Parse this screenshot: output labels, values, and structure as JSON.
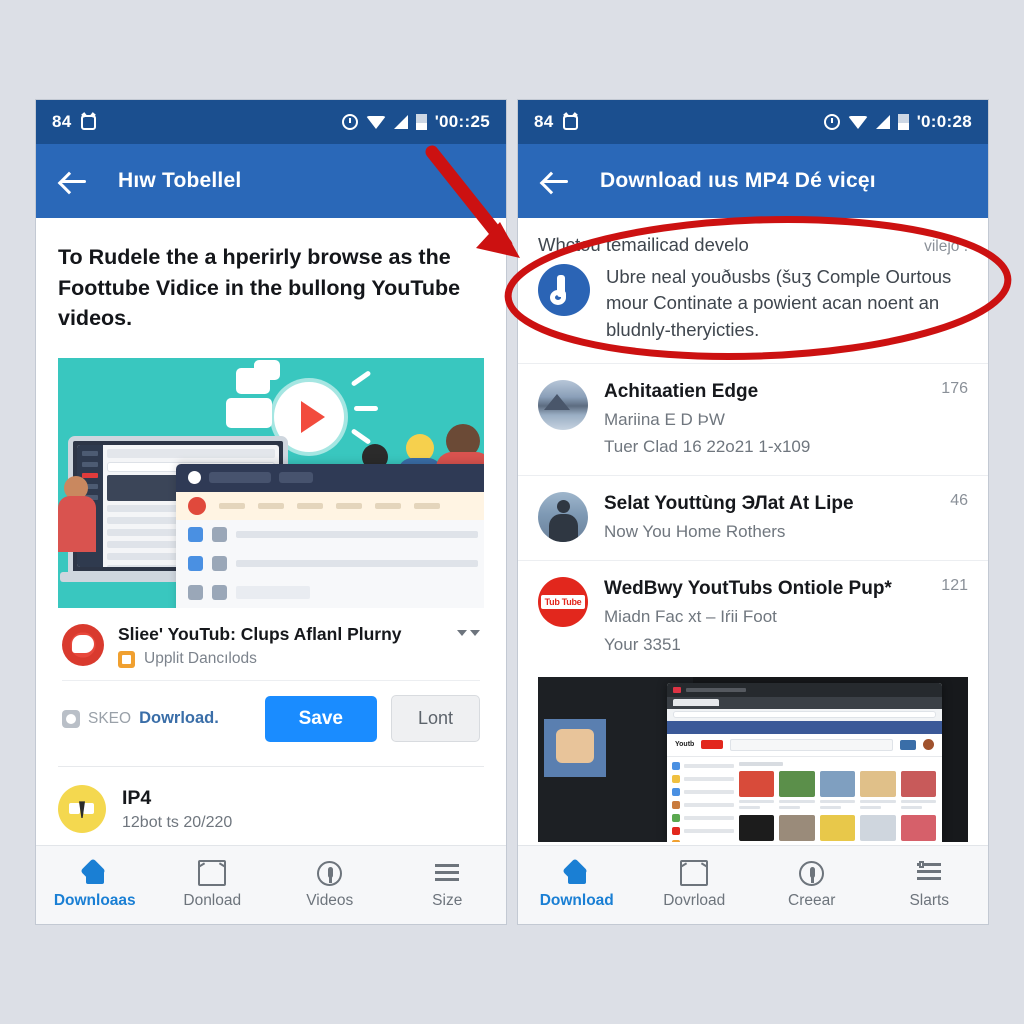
{
  "meta": {
    "accent_blue": "#2a68b8",
    "status_blue": "#1b4f8f",
    "save_blue": "#1a8cff",
    "annotation_red": "#cc1111",
    "page_background": "#dcdfe6"
  },
  "left_panel": {
    "status_bar": {
      "battery_percent": "84",
      "alarm_icon": "alarm-icon",
      "clock_icon": "clock-icon",
      "wifi_icon": "wifi-icon",
      "signal_icon": "signal-icon",
      "battery_icon": "battery-icon",
      "time": "'00::25"
    },
    "app_bar": {
      "back_icon": "back-arrow-icon",
      "title": "Hıw Tobellel"
    },
    "lead_paragraph": "To Rudele the a hperirly browse as the Foottube Vidice in the bullong YouTube videos.",
    "illustration": {
      "alt": "teal illustration with laptop, play button and cartoon people",
      "background": "#39c7bf",
      "play_icon": "play-button-icon"
    },
    "card": {
      "avatar_icon": "channel-avatar-icon",
      "title": "Sliee' YouTub: Clups Aflanl Plurny",
      "badge_icon": "upload-badge-icon",
      "subtitle": "Upplit Dancılods",
      "caret_icon": "chevron-down-icon",
      "seo_icon": "seo-dot-icon",
      "seo_label": "SKEO",
      "seo_link": "Dowrload.",
      "save_label": "Save",
      "ghost_label": "Lont"
    },
    "mp4_row": {
      "icon": "mp4-face-icon",
      "title": "IP4",
      "subtitle": "12bot ts 20/220"
    },
    "bottom_nav": [
      {
        "label": "Downloaas",
        "icon": "home-icon",
        "active": true
      },
      {
        "label": "Donload",
        "icon": "chart-icon",
        "active": false
      },
      {
        "label": "Videos",
        "icon": "pin-icon",
        "active": false
      },
      {
        "label": "Size",
        "icon": "menu-icon",
        "active": false
      }
    ]
  },
  "right_panel": {
    "status_bar": {
      "battery_percent": "84",
      "alarm_icon": "alarm-icon",
      "clock_icon": "clock-icon",
      "wifi_icon": "wifi-icon",
      "signal_icon": "signal-icon",
      "battery_icon": "battery-icon",
      "time": "'0:0:28"
    },
    "app_bar": {
      "back_icon": "back-arrow-icon",
      "title": "Download ıus MP4 Dé vicęı"
    },
    "list_header": {
      "main": "Whctou temailicad develo",
      "side": "vilejo ."
    },
    "featured_item": {
      "icon": "blue-download-app-icon",
      "text": "Ubre neal youðusbs (šuʒ Comple Ourtous mour Continate a powient acan noent an bludnly-theryicties."
    },
    "items": [
      {
        "avatar_icon": "lake-thumbnail-icon",
        "title": "Achitaatien Edge",
        "line1": "Mariina E D ÞW",
        "line2": "Tuer Clad 16 22o21 1-x109",
        "count": "176"
      },
      {
        "avatar_icon": "person-thumbnail-icon",
        "title": "Selat Youttùng ЭЛat At Lipe",
        "line1": "Now You Home Rothers",
        "line2": "",
        "count": "46"
      },
      {
        "avatar_icon": "youtube-logo-icon",
        "title": "WedBwy YoutTubs Ontiole Pup*",
        "line1": "Miadn Fac xt – Iŕii Foot",
        "line2": "Your 3351",
        "count": "121"
      }
    ],
    "browser_screenshot": {
      "alt": "screenshot of a desktop browser showing a YouTube-style video grid",
      "logo_text": "Youtb"
    },
    "bottom_nav": [
      {
        "label": "Download",
        "icon": "home-icon",
        "active": true
      },
      {
        "label": "Dovrload",
        "icon": "chart-icon",
        "active": false
      },
      {
        "label": "Creear",
        "icon": "pin-icon",
        "active": false
      },
      {
        "label": "Slarts",
        "icon": "list-icon",
        "active": false
      }
    ]
  },
  "annotations": {
    "arrow": {
      "name": "red-arrow-annotation",
      "color": "#cc1111"
    },
    "ellipse": {
      "name": "red-ellipse-annotation",
      "color": "#cc1111"
    }
  }
}
